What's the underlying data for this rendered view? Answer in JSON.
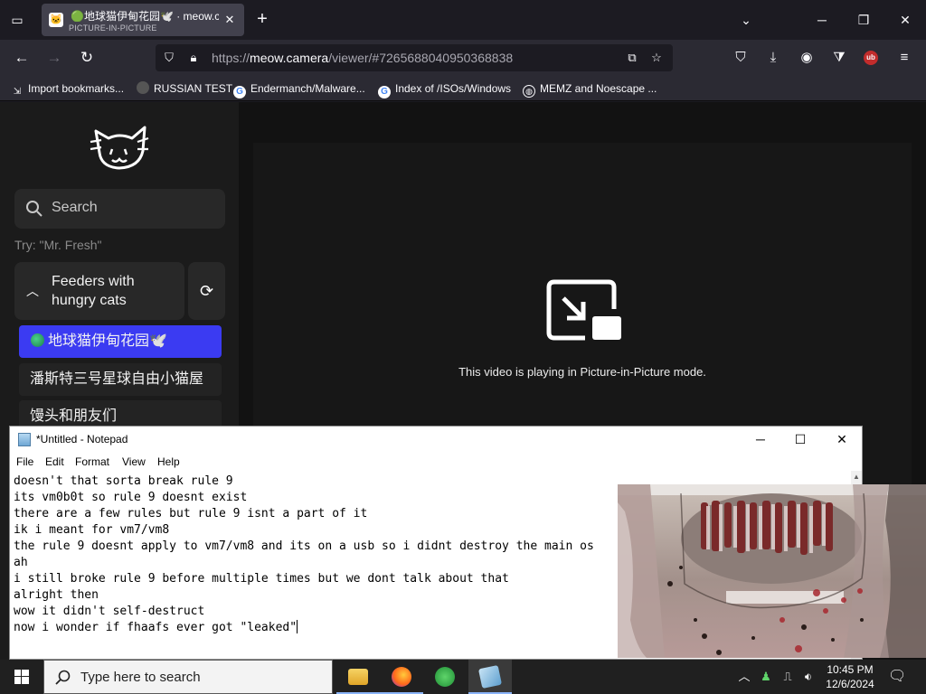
{
  "browser": {
    "tab": {
      "title": "🟢地球猫伊甸花园🕊️ · meow.c",
      "subtitle": "PICTURE-IN-PICTURE"
    },
    "url": {
      "scheme": "https://",
      "host": "meow.camera",
      "path": "/viewer/#7265688040950368838"
    },
    "bookmarks": [
      {
        "label": "Import bookmarks...",
        "icon": "import-icon"
      },
      {
        "label": "RUSSIAN TEST",
        "icon": "site-favicon"
      },
      {
        "label": "Endermanch/Malware...",
        "icon": "google-favicon"
      },
      {
        "label": "Index of /ISOs/Windows",
        "icon": "google-favicon"
      },
      {
        "label": "MEMZ and Noescape ...",
        "icon": "globe-icon"
      }
    ],
    "extension_badge": "ub"
  },
  "page": {
    "search_placeholder": "Search",
    "try_hint": "Try: \"Mr. Fresh\"",
    "section_title": "Feeders with hungry cats",
    "feeders": [
      {
        "label": "地球猫伊甸花园🕊️",
        "active": true,
        "has_dot": true
      },
      {
        "label": "潘斯特三号星球自由小猫屋",
        "active": false,
        "has_dot": false
      },
      {
        "label": "馒头和朋友们",
        "active": false,
        "has_dot": false
      }
    ],
    "pip_message": "This video is playing in Picture-in-Picture mode."
  },
  "notepad": {
    "title": "*Untitled - Notepad",
    "menu": [
      "File",
      "Edit",
      "Format",
      "View",
      "Help"
    ],
    "lines": [
      "doesn't that sorta break rule 9",
      "its vm0b0t so rule 9 doesnt exist",
      "there are a few rules but rule 9 isnt a part of it",
      "ik i meant for vm7/vm8",
      "the rule 9 doesnt apply to vm7/vm8 and its on a usb so i didnt destroy the main os",
      "ah",
      "i still broke rule 9 before multiple times but we dont talk about that",
      "alright then",
      "",
      "wow it didn't self-destruct",
      "now i wonder if fhaafs ever got \"leaked\""
    ]
  },
  "taskbar": {
    "search_placeholder": "Type here to search",
    "time": "10:45 PM",
    "date": "12/6/2024"
  },
  "colors": {
    "accent": "#3b3bf2",
    "browser_bg": "#1c1b22",
    "toolbar_bg": "#2b2a33"
  }
}
